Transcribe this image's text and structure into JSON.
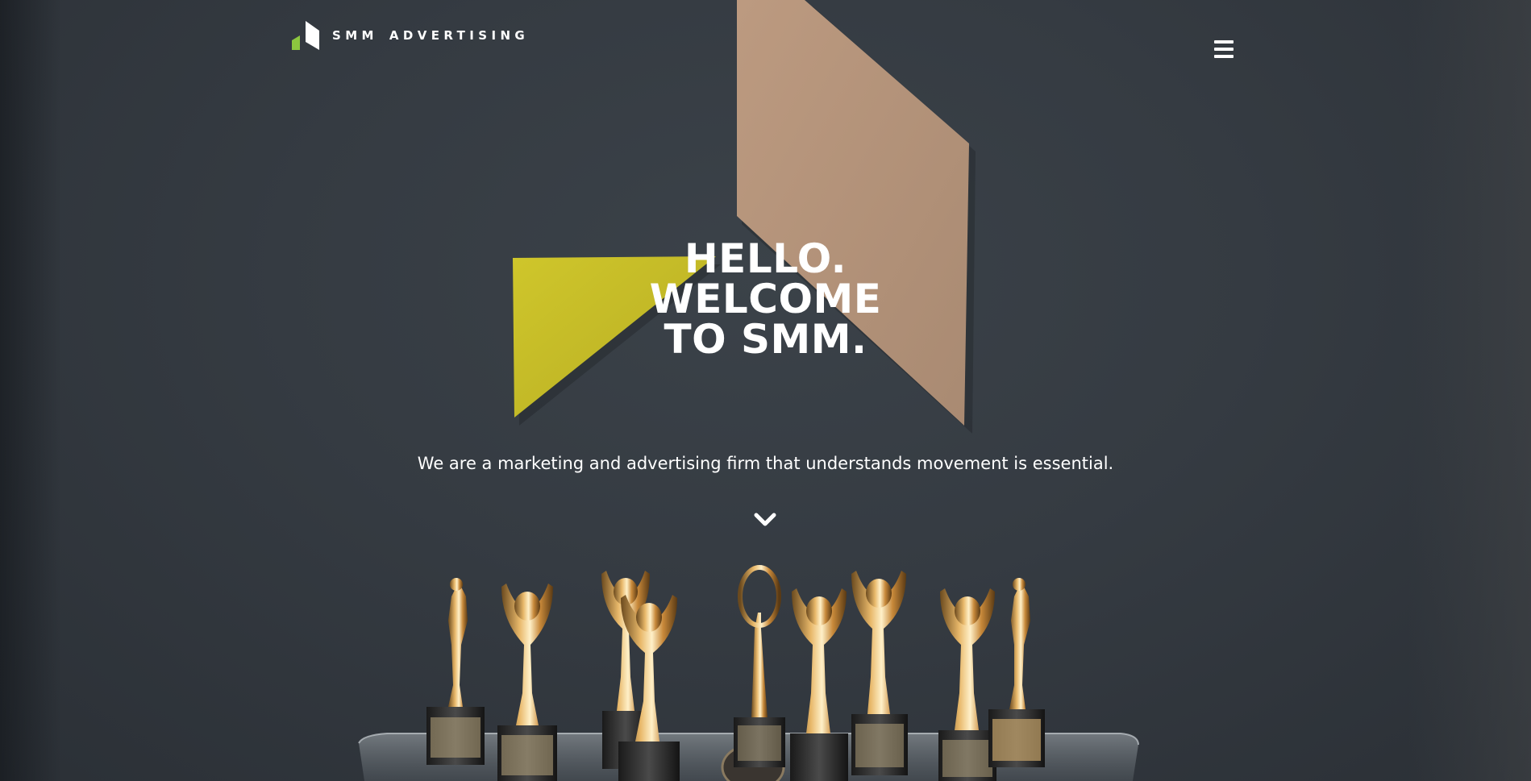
{
  "header": {
    "logo_text_1": "SMM",
    "logo_text_2": "ADVERTISING",
    "logo_icon": "smm-logo-mark",
    "menu_icon": "hamburger-menu-icon"
  },
  "hero": {
    "headline_lines": [
      "HELLO.",
      "WELCOME",
      "TO SMM."
    ],
    "tagline": "We are a marketing and advertising firm that understands movement is essential.",
    "scroll_icon": "chevron-down-icon",
    "background_image": "office-wall-with-logo-sculpture-and-award-trophies"
  },
  "colors": {
    "logo_green": "#8cc63f",
    "sculpture_yellow": "#c9c12a",
    "sculpture_tan": "#b9957a",
    "wall": "#353b42",
    "text": "#ffffff"
  }
}
